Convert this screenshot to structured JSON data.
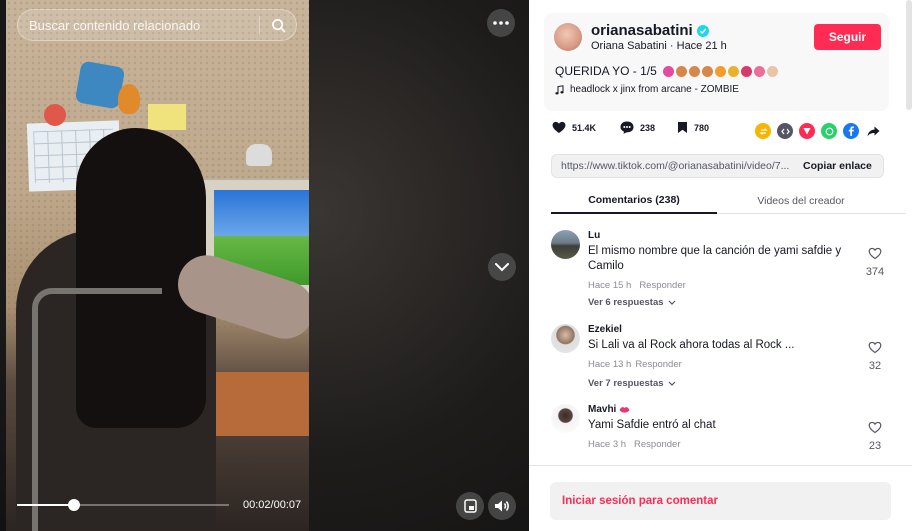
{
  "video": {
    "search_placeholder": "Buscar contenido relacionado",
    "time": "00:02/00:07",
    "progress_fraction": 0.27
  },
  "author": {
    "username": "orianasabatini",
    "display_name": "Oriana Sabatini",
    "separator": "·",
    "posted": "Hace 21 h",
    "follow_label": "Seguir",
    "caption": "QUERIDA YO - 1/5",
    "music": "headlock x jinx from arcane - ZOMBIE"
  },
  "actions": {
    "likes": "51.4K",
    "comments": "238",
    "saves": "780"
  },
  "share_icons": [
    {
      "name": "repost-icon",
      "color": "#f7b500"
    },
    {
      "name": "embed-icon",
      "color": "#545663"
    },
    {
      "name": "send-icon",
      "color": "#fe2c55"
    },
    {
      "name": "whatsapp-icon",
      "color": "#25d366"
    },
    {
      "name": "facebook-icon",
      "color": "#1877f2"
    },
    {
      "name": "share-arrow-icon",
      "color": "#161823"
    }
  ],
  "link": {
    "url": "https://www.tiktok.com/@orianasabatini/video/7...",
    "copy_label": "Copiar enlace"
  },
  "tabs": {
    "comments": "Comentarios (238)",
    "creator_videos": "Videos del creador"
  },
  "comments": [
    {
      "user": "Lu",
      "text": "El mismo nombre que la canción de yami safdie y Camilo",
      "time": "Hace 15 h",
      "reply": "Responder",
      "more": "Ver 6 respuestas",
      "likes": "374"
    },
    {
      "user": "Ezekiel",
      "text": "Si Lali va al Rock ahora todas al Rock ...",
      "time": "Hace 13 h",
      "reply": "Responder",
      "more": "Ver 7 respuestas",
      "likes": "32"
    },
    {
      "user": "Mavhi",
      "text": "Yami Safdie entró al chat",
      "time": "Hace 3 h",
      "reply": "Responder",
      "likes": "23"
    }
  ],
  "login_prompt": "Iniciar sesión para comentar"
}
